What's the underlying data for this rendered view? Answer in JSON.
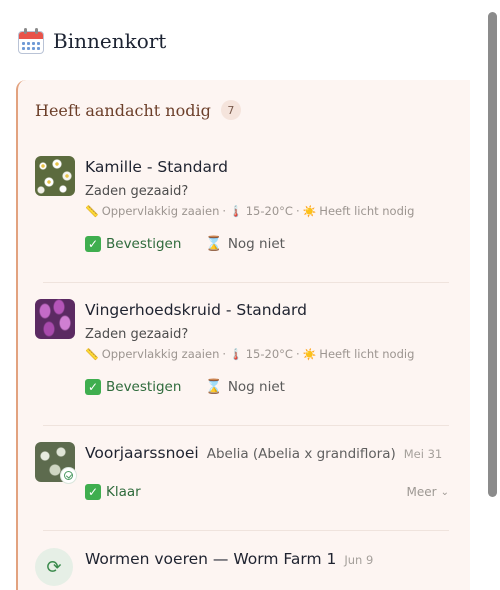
{
  "header": {
    "icon": "calendar-icon",
    "title": "Binnenkort"
  },
  "section": {
    "title": "Heeft aandacht nodig",
    "count": "7",
    "accent": "#e2a27f"
  },
  "tasks": [
    {
      "thumb": "chamomile-photo",
      "title": "Kamille - Standard",
      "question": "Zaden gezaaid?",
      "meta": {
        "depth": "Oppervlakkig zaaien",
        "temp": "15-20°C",
        "light": "Heeft licht nodig"
      },
      "confirm_label": "Bevestigen",
      "later_label": "Nog niet"
    },
    {
      "thumb": "foxglove-photo",
      "title": "Vingerhoedskruid - Standard",
      "question": "Zaden gezaaid?",
      "meta": {
        "depth": "Oppervlakkig zaaien",
        "temp": "15-20°C",
        "light": "Heeft licht nodig"
      },
      "confirm_label": "Bevestigen",
      "later_label": "Nog niet"
    },
    {
      "thumb": "abelia-photo",
      "title": "Voorjaarssnoei",
      "plant": "Abelia (Abelia x grandiflora)",
      "date": "Mei 31",
      "done_label": "Klaar",
      "more_label": "Meer"
    },
    {
      "icon": "refresh-icon",
      "title": "Wormen voeren — Worm Farm 1",
      "date": "Jun 9"
    }
  ],
  "colors": {
    "confirm": "#2f6b3c",
    "panel_bg": "#fdf5f2"
  }
}
